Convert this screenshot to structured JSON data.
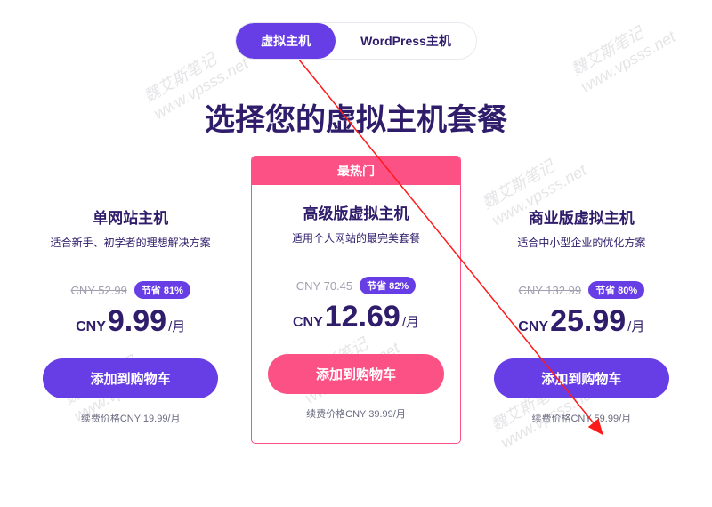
{
  "tabs": {
    "virtual_hosting": "虚拟主机",
    "wordpress_hosting": "WordPress主机"
  },
  "heading": "选择您的虚拟主机套餐",
  "watermark_text": "魏艾斯笔记\nwww.vpsss.net",
  "plans": [
    {
      "badge": "",
      "title": "单网站主机",
      "subtitle": "适合新手、初学者的理想解决方案",
      "old_price": "CNY 52.99",
      "save_label": "节省 81%",
      "currency": "CNY",
      "price": "9.99",
      "period": "/月",
      "button_label": "添加到购物车",
      "button_style": "purple",
      "renewal": "续费价格CNY 19.99/月"
    },
    {
      "badge": "最热门",
      "title": "高级版虚拟主机",
      "subtitle": "适用个人网站的最完美套餐",
      "old_price": "CNY 70.45",
      "save_label": "节省 82%",
      "currency": "CNY",
      "price": "12.69",
      "period": "/月",
      "button_label": "添加到购物车",
      "button_style": "pink",
      "renewal": "续费价格CNY 39.99/月"
    },
    {
      "badge": "",
      "title": "商业版虚拟主机",
      "subtitle": "适合中小型企业的优化方案",
      "old_price": "CNY 132.99",
      "save_label": "节省 80%",
      "currency": "CNY",
      "price": "25.99",
      "period": "/月",
      "button_label": "添加到购物车",
      "button_style": "purple",
      "renewal": "续费价格CNY 59.99/月"
    }
  ]
}
